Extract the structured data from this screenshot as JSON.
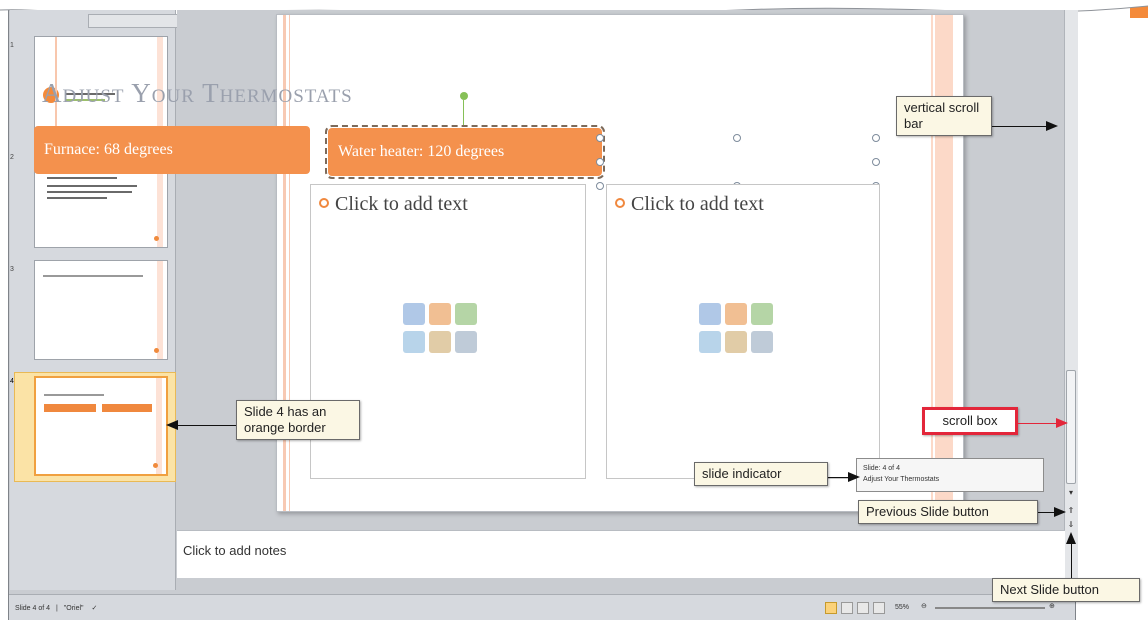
{
  "thumbnails": [
    {
      "number": "1"
    },
    {
      "number": "2"
    },
    {
      "number": "3"
    },
    {
      "number": "4"
    }
  ],
  "slide": {
    "title": "Adjust Your Thermostats",
    "header_left": "Furnace: 68 degrees",
    "header_right": "Water heater: 120 degrees",
    "content_left": "Click to add text",
    "content_right": "Click to add text"
  },
  "tooltip": {
    "line1": "Slide: 4 of 4",
    "line2": "Adjust Your Thermostats"
  },
  "notes": {
    "placeholder": "Click to add notes"
  },
  "status_bar": {
    "slide_info": "Slide 4 of 4",
    "theme": "\"Oriel\"",
    "zoom": "55%"
  },
  "callouts": {
    "vertical_scroll_bar": "vertical scroll bar",
    "slide4_border": "Slide 4 has an orange border",
    "scroll_box": "scroll box",
    "slide_indicator": "slide indicator",
    "previous_slide": "Previous Slide button",
    "next_slide": "Next Slide button"
  },
  "colors": {
    "accent_orange": "#f4914d",
    "callout_bg": "#fbf7e4",
    "scroll_box_border": "#e3263a"
  }
}
